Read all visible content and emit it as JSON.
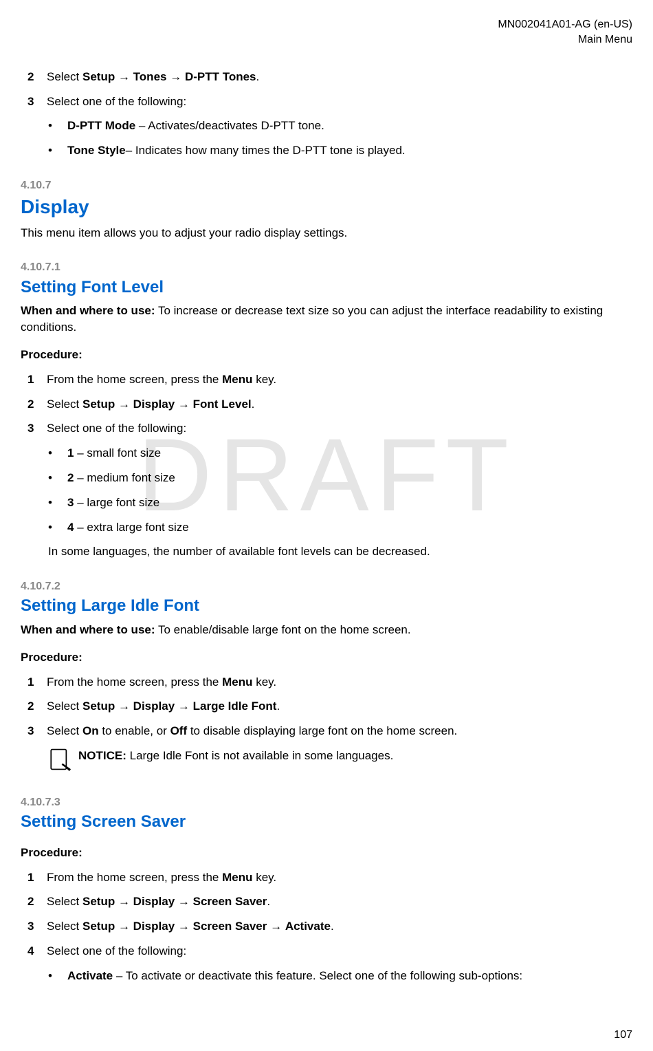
{
  "header": {
    "doc_id": "MN002041A01-AG (en-US)",
    "section": "Main Menu"
  },
  "watermark": "DRAFT",
  "page_number": "107",
  "intro_steps": {
    "step2": {
      "num": "2",
      "prefix": "Select ",
      "bold1": "Setup",
      "arrow1": " → ",
      "bold2": "Tones",
      "arrow2": " → ",
      "bold3": "D-PTT Tones",
      "suffix": "."
    },
    "step3": {
      "num": "3",
      "text": "Select one of the following:"
    },
    "bullet1": {
      "bold": "D-PTT Mode",
      "rest": " – Activates/deactivates D-PTT tone."
    },
    "bullet2": {
      "bold": "Tone Style",
      "rest": "– Indicates how many times the D-PTT tone is played."
    }
  },
  "s4107": {
    "num": "4.10.7",
    "title": "Display",
    "desc": "This menu item allows you to adjust your radio display settings."
  },
  "s41071": {
    "num": "4.10.7.1",
    "title": "Setting Font Level",
    "when_label": "When and where to use:",
    "when_text": " To increase or decrease text size so you can adjust the interface readability to existing conditions.",
    "proc_label": "Procedure:",
    "step1": {
      "num": "1",
      "prefix": "From the home screen, press the ",
      "bold": "Menu",
      "suffix": " key."
    },
    "step2": {
      "num": "2",
      "prefix": "Select ",
      "b1": "Setup",
      "a1": " → ",
      "b2": "Display",
      "a2": " → ",
      "b3": "Font Level",
      "suffix": "."
    },
    "step3": {
      "num": "3",
      "text": "Select one of the following:"
    },
    "opt1": {
      "bold": "1",
      "rest": " – small font size"
    },
    "opt2": {
      "bold": "2",
      "rest": " – medium font size"
    },
    "opt3": {
      "bold": "3",
      "rest": " – large font size"
    },
    "opt4": {
      "bold": "4",
      "rest": " – extra large font size"
    },
    "note": "In some languages, the number of available font levels can be decreased."
  },
  "s41072": {
    "num": "4.10.7.2",
    "title": "Setting Large Idle Font",
    "when_label": "When and where to use:",
    "when_text": " To enable/disable large font on the home screen.",
    "proc_label": "Procedure:",
    "step1": {
      "num": "1",
      "prefix": "From the home screen, press the ",
      "bold": "Menu",
      "suffix": " key."
    },
    "step2": {
      "num": "2",
      "prefix": "Select ",
      "b1": "Setup",
      "a1": " → ",
      "b2": "Display",
      "a2": " → ",
      "b3": "Large Idle Font",
      "suffix": "."
    },
    "step3": {
      "num": "3",
      "prefix": "Select ",
      "b1": "On",
      "mid1": " to enable, or ",
      "b2": "Off",
      "suffix": " to disable displaying large font on the home screen."
    },
    "notice_label": "NOTICE:",
    "notice_text": " Large Idle Font is not available in some languages."
  },
  "s41073": {
    "num": "4.10.7.3",
    "title": "Setting Screen Saver",
    "proc_label": "Procedure:",
    "step1": {
      "num": "1",
      "prefix": "From the home screen, press the ",
      "bold": "Menu",
      "suffix": " key."
    },
    "step2": {
      "num": "2",
      "prefix": "Select ",
      "b1": "Setup",
      "a1": " → ",
      "b2": "Display",
      "a2": " → ",
      "b3": "Screen Saver",
      "suffix": "."
    },
    "step3": {
      "num": "3",
      "prefix": "Select ",
      "b1": "Setup",
      "a1": " → ",
      "b2": "Display",
      "a2": " → ",
      "b3": "Screen Saver",
      "a3": " → ",
      "b4": "Activate",
      "suffix": "."
    },
    "step4": {
      "num": "4",
      "text": "Select one of the following:"
    },
    "opt1": {
      "bold": "Activate",
      "rest": " – To activate or deactivate this feature. Select one of the following sub-options:"
    }
  }
}
